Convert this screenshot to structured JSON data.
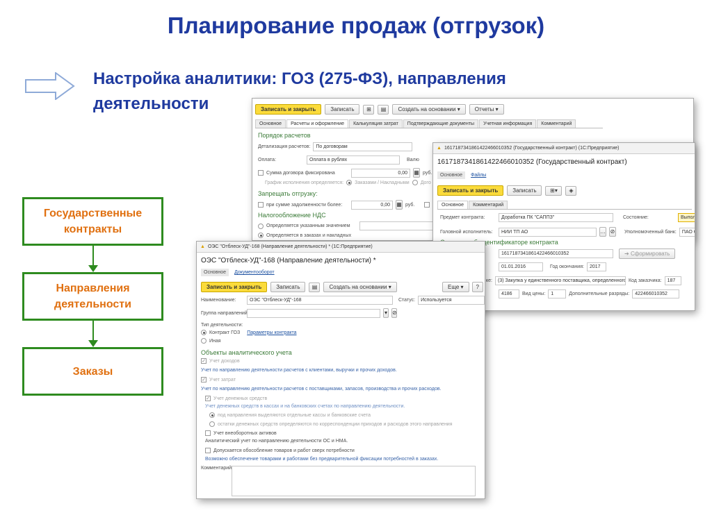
{
  "slide": {
    "title": "Планирование продаж (отгрузок)",
    "subtitle_line1": "Настройка аналитики: ГОЗ (275-ФЗ), направления",
    "subtitle_line2": "деятельности",
    "boxes": [
      "Государственные контракты",
      "Направления деятельности",
      "Заказы"
    ],
    "box_lines": [
      [
        "Государственные",
        "контракты"
      ],
      [
        "Направления",
        "деятельности"
      ],
      [
        "Заказы"
      ]
    ]
  },
  "w1": {
    "toolbar": {
      "save_close": "Записать и закрыть",
      "save": "Записать",
      "create_based": "Создать на основании ▾",
      "reports": "Отчеты ▾"
    },
    "tabs": [
      "Основное",
      "Расчеты и оформление",
      "Калькуляция затрат",
      "Подтверждающие документы",
      "Учетная информация",
      "Комментарий"
    ],
    "sec_payment": "Порядок расчетов",
    "detail_label": "Детализация расчетов:",
    "detail_value": "По договорам",
    "pay_label": "Оплата:",
    "pay_value": "Оплата в рублях",
    "pay_trunc": "Валю",
    "sum_fixed": "Сумма договора фиксирована",
    "sum_value": "0,00",
    "rub": "руб.",
    "schedule": "График исполнения определяется:",
    "schedule_opt1": "Заказами / Накладными",
    "schedule_opt2": "Дого",
    "sec_ship": "Запрещать отгрузку:",
    "debt_label": "при сумме задолженности более:",
    "debt_value": "0,00",
    "rub2": "руб.",
    "debt_trunc": "п",
    "sec_vat": "Налогообложение НДС",
    "vat_opt1": "Определяется указанным значением",
    "vat_opt2": "Определяется в заказах и накладных"
  },
  "w2": {
    "titlebar": "1617187341861422466010352 (Государственный контракт) (1С:Предприятие)",
    "heading": "1617187341861422466010352 (Государственный контракт)",
    "nav": [
      "Основное",
      "Файлы"
    ],
    "toolbar": {
      "save_close": "Записать и закрыть",
      "save": "Записать"
    },
    "tabs": [
      "Основное",
      "Комментарий"
    ],
    "subject_label": "Предмет контракта:",
    "subject_value": "Доработка ПК \"САППЗ\"",
    "state_label": "Состояние:",
    "state_value": "Выполня",
    "exec_label": "Головной исполнитель:",
    "exec_value": "НИИ ТП АО",
    "bank_label": "Уполномоченный банк:",
    "bank_value": "ПАО СБЕ",
    "sec_ident": "Сведения об идентификаторе контракта",
    "ident_value": "1617187341861422466010352",
    "form_btn": "Сформировать",
    "date_value": "01.01.2016",
    "end_label": "Год окончания:",
    "end_value": "2017",
    "code_trunc": "ке:",
    "purchase_value": "(3) Закупка у единственного поставщика, определенного",
    "customer_label": "Код заказчика:",
    "customer_value": "187",
    "num_value": "4186",
    "price_label": "Вид цены:",
    "price_value": "1",
    "extra_label": "Дополнительные разряды:",
    "extra_value": "422466010352"
  },
  "w3": {
    "titlebar": "ОЭС \"Отблеск-УД\"-168 (Направление деятельности) * (1С:Предприятие)",
    "heading": "ОЭС \"Отблеск-УД\"-168 (Направление деятельности) *",
    "nav": [
      "Основное",
      "Документооборот"
    ],
    "toolbar": {
      "save_close": "Записать и закрыть",
      "save": "Записать",
      "create_based": "Создать на основании ▾",
      "more": "Еще ▾",
      "help": "?"
    },
    "name_label": "Наименование:",
    "name_value": "ОЭС \"Отблеск-УД\"-168",
    "status_label": "Статус:",
    "status_value": "Используется",
    "group_label": "Группа направлений:",
    "type_label": "Тип деятельности:",
    "type_goz": "Контракт ГОЗ",
    "type_params": "Параметры контракта",
    "type_other": "Иная",
    "sec_objects": "Объекты аналитического учета",
    "income": "Учет доходов",
    "income_note": "Учет по направлению деятельности расчетов с клиентами, выручки и прочих доходов.",
    "costs": "Учет затрат",
    "costs_note": "Учет по направлению деятельности расчетов с поставщиками, запасов, производства и прочих расходов.",
    "cash": "Учет денежных средств",
    "cash_note": "Учет денежных средств в кассах и на банковских счетах по направлению деятельности.",
    "cash_opt1": "под направления выделяются отдельные кассы и банковские счета",
    "cash_opt2": "остатки денежных средств определяются по корреспонденции приходов и расходов этого направления",
    "fixed": "Учет внеоборотных активов",
    "fixed_note": "Аналитический учет по направлению деятельности ОС и НМА.",
    "goods": "Допускается обособление товаров и работ сверх потребности",
    "goods_note": "Возможно обеспечение товарами и работами без предварительной фиксации потребностей в заказах.",
    "comment_label": "Комментарий:"
  },
  "colors": {
    "title_blue": "#1f3a9f",
    "box_green": "#2e8b1f",
    "box_text_orange": "#e07010",
    "button_yellow": "#fbdb3b"
  }
}
